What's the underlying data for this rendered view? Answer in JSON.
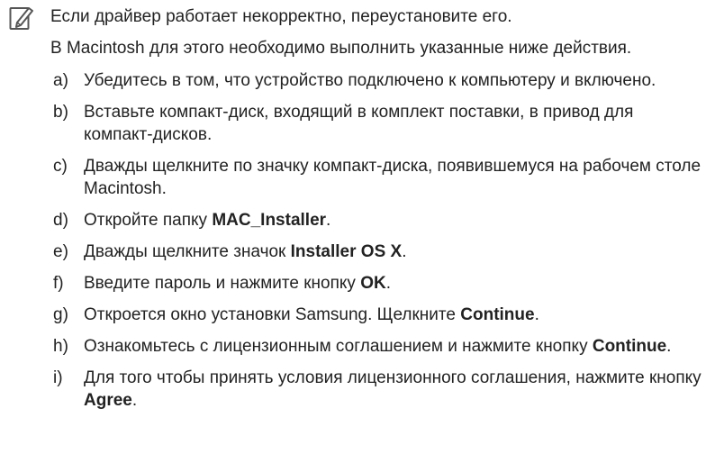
{
  "note": {
    "icon": "pencil-note-icon",
    "intro": [
      "Если драйвер работает некорректно, переустановите его.",
      "В Macintosh для этого необходимо выполнить указанные ниже действия."
    ],
    "steps": [
      {
        "letter": "a)",
        "text": "Убедитесь в том, что устройство подключено к компьютеру и включено.",
        "bold": ""
      },
      {
        "letter": "b)",
        "text": "Вставьте компакт-диск, входящий в комплект поставки, в привод для компакт-дисков.",
        "bold": ""
      },
      {
        "letter": "c)",
        "text": "Дважды щелкните по значку компакт-диска, появившемуся на рабочем столе Macintosh.",
        "bold": ""
      },
      {
        "letter": "d)",
        "text": "Откройте папку ",
        "bold": "MAC_Installer",
        "after": "."
      },
      {
        "letter": "e)",
        "text": "Дважды щелкните значок ",
        "bold": "Installer OS X",
        "after": "."
      },
      {
        "letter": "f)",
        "text": "Введите пароль и нажмите кнопку ",
        "bold": "OK",
        "after": "."
      },
      {
        "letter": "g)",
        "text": "Откроется окно установки Samsung. Щелкните ",
        "bold": "Continue",
        "after": "."
      },
      {
        "letter": "h)",
        "text": "Ознакомьтесь с лицензионным соглашением и нажмите кнопку ",
        "bold": "Continue",
        "after": "."
      },
      {
        "letter": "i)",
        "text": "Для того чтобы принять условия лицензионного соглашения, нажмите кнопку ",
        "bold": "Agree",
        "after": "."
      }
    ]
  }
}
